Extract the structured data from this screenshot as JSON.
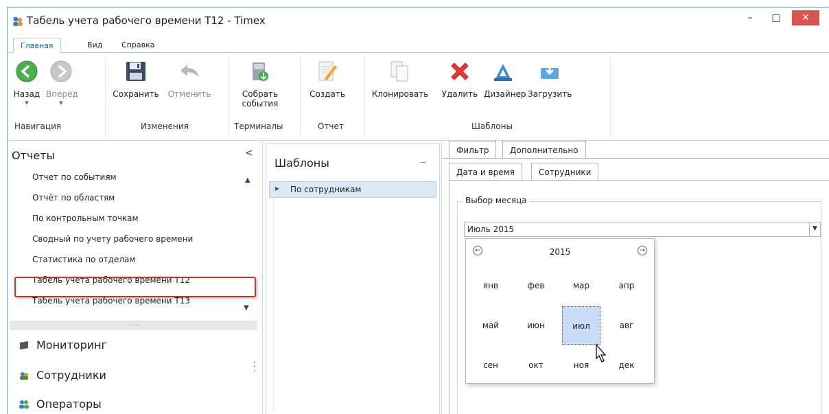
{
  "window": {
    "title": "Табель учета рабочего времени Т12 - Timex",
    "min": "–",
    "max": "□",
    "close": "✕"
  },
  "ribbon_tabs": [
    "Главная",
    "Вид",
    "Справка"
  ],
  "ribbon": {
    "back": "Назад",
    "forward": "Вперед",
    "save": "Сохранить",
    "cancel": "Отменить",
    "collect": "Собрать\nсобытия",
    "create": "Создать",
    "clone": "Клонировать",
    "delete": "Удалить",
    "designer": "Дизайнер",
    "load": "Загрузить",
    "groups": {
      "navigation": "Навигация",
      "changes": "Изменения",
      "terminals": "Терминалы",
      "report": "Отчет",
      "templates": "Шаблоны"
    }
  },
  "left": {
    "header": "Отчеты",
    "collapse": "<",
    "reports": [
      "Отчет по событиям",
      "Отчёт по областям",
      "По контрольным точкам",
      "Сводный по учету рабочего времени",
      "Статистика по отделам",
      "Табель учета рабочего времени Т12",
      "Табель учета рабочего времени Т13"
    ],
    "splitter": "......",
    "nav": [
      "Мониторинг",
      "Сотрудники",
      "Операторы"
    ]
  },
  "templates": {
    "header": "Шаблоны",
    "pin": "ᅲ",
    "rows": [
      "По сотрудникам"
    ]
  },
  "filter": {
    "tabs": [
      "Фильтр",
      "Дополнительно"
    ],
    "subtabs": [
      "Дата и время",
      "Сотрудники"
    ],
    "legend": "Выбор месяца",
    "combo_value": "Июль 2015",
    "year": "2015",
    "prev": "←",
    "next": "→",
    "months": [
      "янв",
      "фев",
      "мар",
      "апр",
      "май",
      "июн",
      "июл",
      "авг",
      "сен",
      "окт",
      "ноя",
      "дек"
    ],
    "selected_month_index": 6
  },
  "colors": {
    "accent": "#1a5fb4",
    "selection": "#c9def6",
    "highlight": "#c0392b",
    "close": "#d9534f"
  }
}
